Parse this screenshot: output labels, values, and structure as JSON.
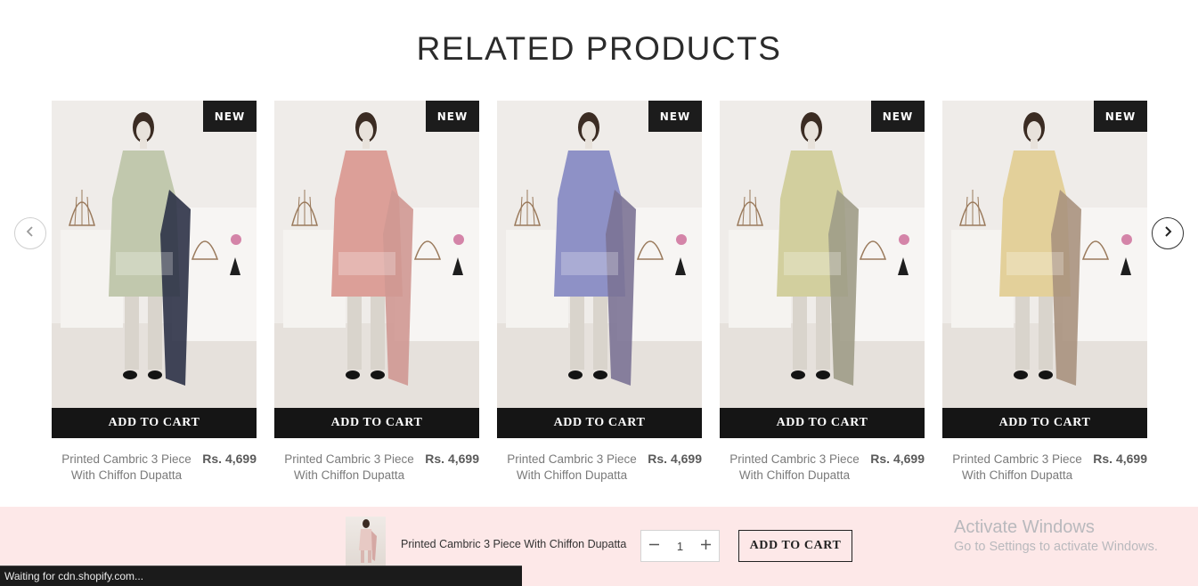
{
  "section": {
    "title": "RELATED PRODUCTS"
  },
  "carousel": {
    "prev_icon": "chevron-left-icon",
    "next_icon": "chevron-right-icon"
  },
  "products": [
    {
      "badge": "NEW",
      "add_to_cart": "ADD TO CART",
      "name": "Printed Cambric 3 Piece With Chiffon Dupatta",
      "price": "Rs. 4,699",
      "shirt_color": "#c1c8ad",
      "dupatta_color": "#2c3247"
    },
    {
      "badge": "NEW",
      "add_to_cart": "ADD TO CART",
      "name": "Printed Cambric 3 Piece With Chiffon Dupatta",
      "price": "Rs. 4,699",
      "shirt_color": "#dc9f98",
      "dupatta_color": "#cf9892"
    },
    {
      "badge": "NEW",
      "add_to_cart": "ADD TO CART",
      "name": "Printed Cambric 3 Piece With Chiffon Dupatta",
      "price": "Rs. 4,699",
      "shirt_color": "#8e91c6",
      "dupatta_color": "#7b7395"
    },
    {
      "badge": "NEW",
      "add_to_cart": "ADD TO CART",
      "name": "Printed Cambric 3 Piece With Chiffon Dupatta",
      "price": "Rs. 4,699",
      "shirt_color": "#d2cf9e",
      "dupatta_color": "#9e9c87"
    },
    {
      "badge": "NEW",
      "add_to_cart": "ADD TO CART",
      "name": "Printed Cambric 3 Piece With Chiffon Dupatta",
      "price": "Rs. 4,699",
      "shirt_color": "#e3d09a",
      "dupatta_color": "#a8927e"
    }
  ],
  "sticky_bar": {
    "product_name": "Printed Cambric 3 Piece With Chiffon Dupatta",
    "quantity": "1",
    "minus_icon": "minus-icon",
    "plus_icon": "plus-icon",
    "add_to_cart": "ADD TO CART",
    "background": "#fde8e8",
    "thumb_shirt_color": "#e7c9c4"
  },
  "watermark": {
    "line1": "Activate Windows",
    "line2": "Go to Settings to activate Windows."
  },
  "status_bar": {
    "text": "Waiting for cdn.shopify.com..."
  }
}
